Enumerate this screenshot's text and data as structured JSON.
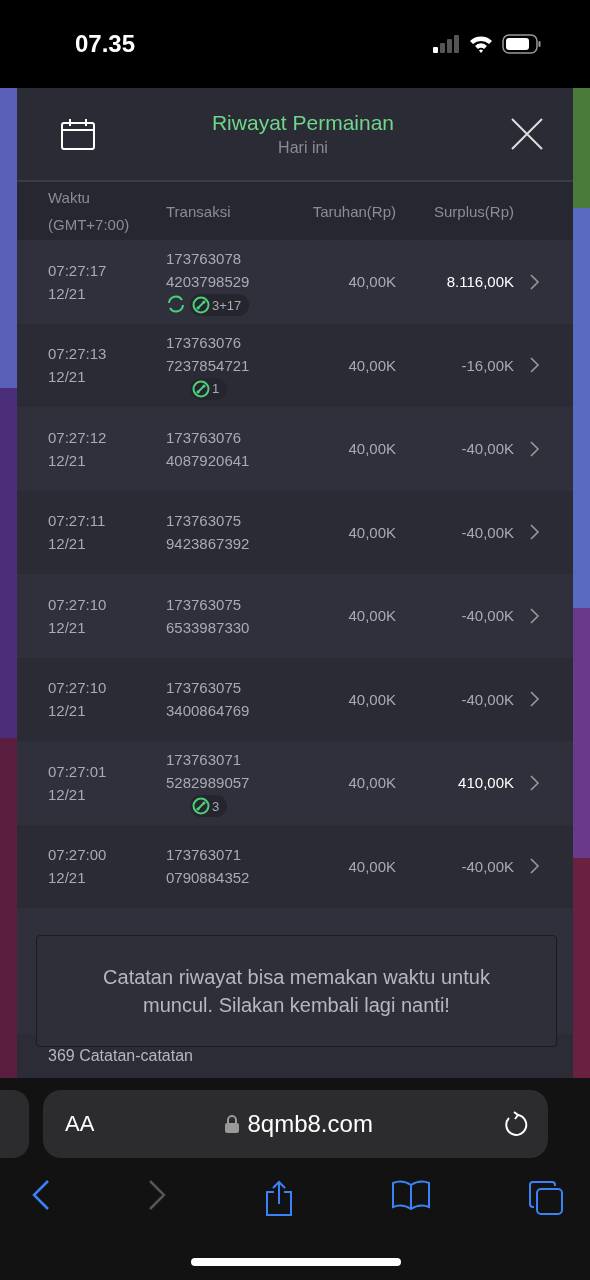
{
  "status_bar": {
    "time": "07.35"
  },
  "dialog": {
    "title": "Riwayat Permainan",
    "subtitle": "Hari ini",
    "columns": [
      {
        "lines": [
          "Waktu",
          "(GMT+7:00)"
        ]
      },
      {
        "lines": [
          "Transaksi"
        ]
      },
      {
        "lines": [
          "Taruhan(Rp)"
        ]
      },
      {
        "lines": [
          "Surplus(Rp)"
        ]
      }
    ],
    "rows": [
      {
        "time": "07:27:17",
        "date": "12/21",
        "id_1": "173763078",
        "id_2": "4203798529",
        "refresh": true,
        "ball_count": "3+17",
        "bet": "40,00K",
        "surplus": "8.116,00K",
        "kind": "win"
      },
      {
        "time": "07:27:13",
        "date": "12/21",
        "id_1": "173763076",
        "id_2": "7237854721",
        "refresh": false,
        "ball_count": "1",
        "bet": "40,00K",
        "surplus": "-16,00K",
        "kind": "loss"
      },
      {
        "time": "07:27:12",
        "date": "12/21",
        "id_1": "173763076",
        "id_2": "4087920641",
        "refresh": false,
        "bet": "40,00K",
        "surplus": "-40,00K",
        "kind": "loss"
      },
      {
        "time": "07:27:11",
        "date": "12/21",
        "id_1": "173763075",
        "id_2": "9423867392",
        "refresh": false,
        "bet": "40,00K",
        "surplus": "-40,00K",
        "kind": "loss"
      },
      {
        "time": "07:27:10",
        "date": "12/21",
        "id_1": "173763075",
        "id_2": "6533987330",
        "refresh": false,
        "bet": "40,00K",
        "surplus": "-40,00K",
        "kind": "loss"
      },
      {
        "time": "07:27:10",
        "date": "12/21",
        "id_1": "173763075",
        "id_2": "3400864769",
        "refresh": false,
        "bet": "40,00K",
        "surplus": "-40,00K",
        "kind": "loss"
      },
      {
        "time": "07:27:01",
        "date": "12/21",
        "id_1": "173763071",
        "id_2": "5282989057",
        "refresh": false,
        "ball_count": "3",
        "bet": "40,00K",
        "surplus": "410,00K",
        "kind": "win"
      },
      {
        "time": "07:27:00",
        "date": "12/21",
        "id_1": "173763071",
        "id_2": "0790884352",
        "refresh": false,
        "bet": "40,00K",
        "surplus": "-40,00K",
        "kind": "loss"
      }
    ],
    "footer": "369 Catatan-catatan"
  },
  "toast": "Catatan riwayat bisa memakan waktu untuk muncul. Silakan kembali lagi nanti!",
  "browser": {
    "url": "8qmb8.com",
    "text_size_label": "AA"
  }
}
